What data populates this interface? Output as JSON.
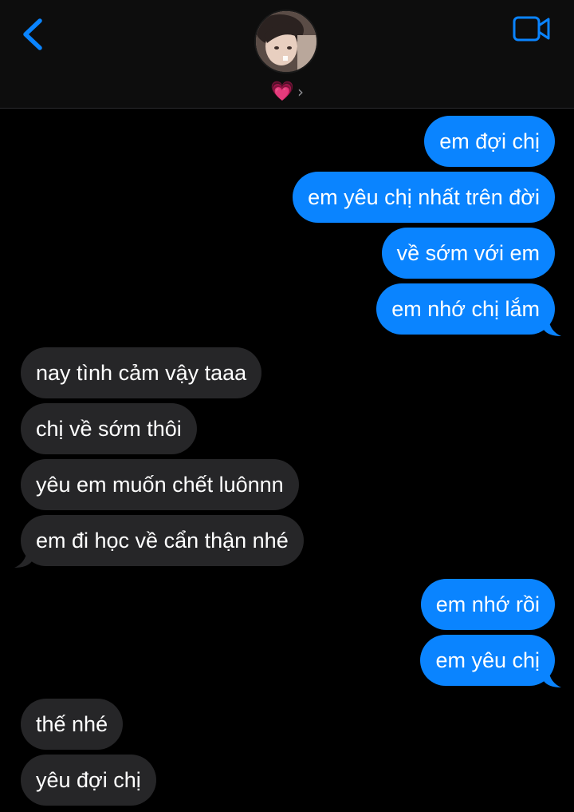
{
  "colors": {
    "accent": "#0a84ff",
    "sent_bubble": "#0a84ff",
    "received_bubble": "#262628",
    "background": "#000000",
    "header_background": "#0d0d0d",
    "heart": "#ff4fa3"
  },
  "header": {
    "back_icon": "chevron-left-icon",
    "contact_name": "💗",
    "contact_chevron": "›",
    "video_icon": "video-camera-icon"
  },
  "messages": [
    {
      "direction": "sent",
      "text": "em đợi chị"
    },
    {
      "direction": "sent",
      "text": "em yêu chị nhất trên đời"
    },
    {
      "direction": "sent",
      "text": "về sớm với em"
    },
    {
      "direction": "sent",
      "text": "em nhớ chị lắm"
    },
    {
      "direction": "received",
      "text": "nay tình cảm vậy taaa"
    },
    {
      "direction": "received",
      "text": "chị về sớm thôi"
    },
    {
      "direction": "received",
      "text": "yêu em muốn chết luônnn"
    },
    {
      "direction": "received",
      "text": "em đi học về cẩn thận nhé"
    },
    {
      "direction": "sent",
      "text": "em nhớ rồi"
    },
    {
      "direction": "sent",
      "text": "em yêu chị"
    },
    {
      "direction": "received",
      "text": "thế nhé"
    },
    {
      "direction": "received",
      "text": "yêu đợi chị"
    }
  ]
}
